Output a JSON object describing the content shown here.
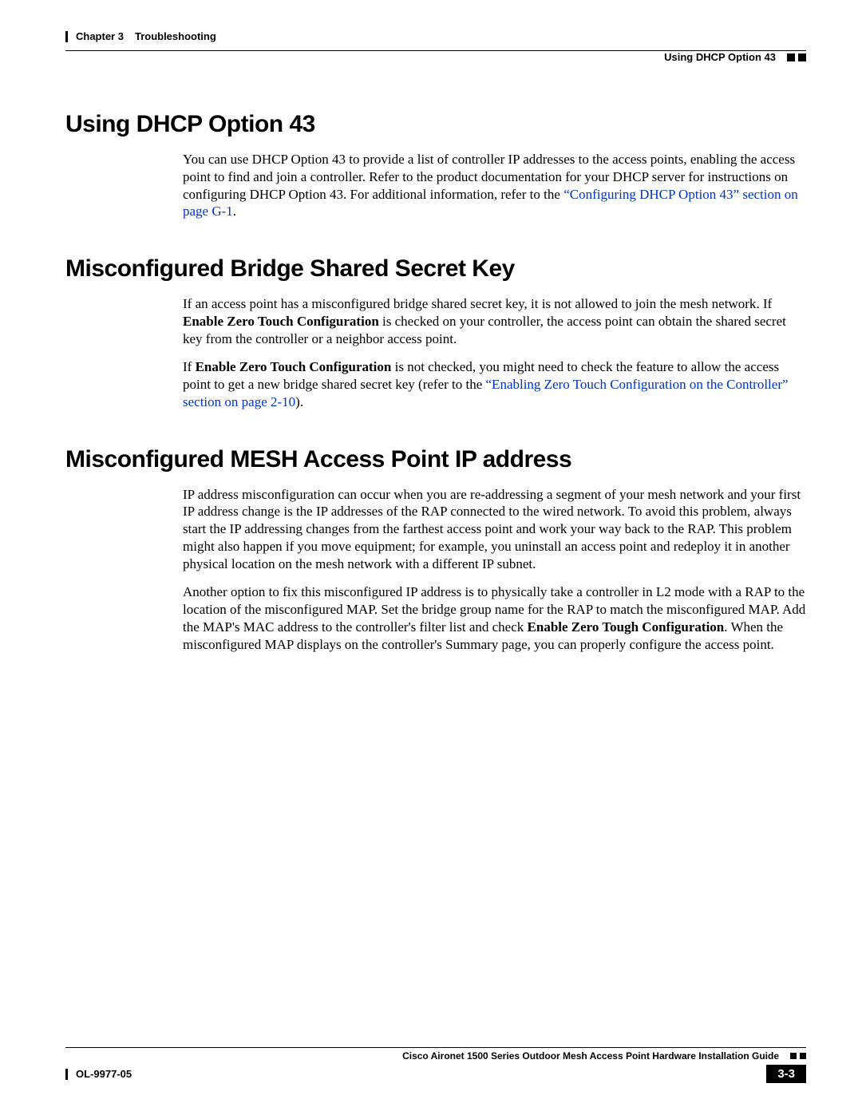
{
  "header": {
    "chapter_label": "Chapter 3",
    "chapter_title": "Troubleshooting",
    "running_head": "Using DHCP Option 43"
  },
  "sections": {
    "s1": {
      "title": "Using DHCP Option 43",
      "p1a": "You can use DHCP Option 43 to provide a list of controller IP addresses to the access points, enabling the access point to find and join a controller. Refer to the product documentation for your DHCP server for instructions on configuring DHCP Option 43. For additional information, refer to the ",
      "p1link": "“Configuring DHCP Option 43” section on page G-1",
      "p1b": "."
    },
    "s2": {
      "title": "Misconfigured Bridge Shared Secret Key",
      "p1a": "If an access point has a misconfigured bridge shared secret key, it is not allowed to join the mesh network. If ",
      "p1bold": "Enable Zero Touch Configuration",
      "p1b": " is checked on your controller, the access point can obtain the shared secret key from the controller or a neighbor access point.",
      "p2a": "If ",
      "p2bold": "Enable Zero Touch Configuration",
      "p2b": " is not checked, you might need to check the feature to allow the access point to get a new bridge shared secret key (refer to the ",
      "p2link": "“Enabling Zero Touch Configuration on the Controller” section on page 2-10",
      "p2c": ")."
    },
    "s3": {
      "title": "Misconfigured MESH Access Point IP address",
      "p1": "IP address misconfiguration can occur when you are re-addressing a segment of your mesh network and your first IP address change is the IP addresses of the RAP connected to the wired network. To avoid this problem, always start the IP addressing changes from the farthest access point and work your way back to the RAP. This problem might also happen if you move equipment; for example, you uninstall an access point and redeploy it in another physical location on the mesh network with a different IP subnet.",
      "p2a": "Another option to fix this misconfigured IP address is to physically take a controller in L2 mode with a RAP to the location of the misconfigured MAP. Set the bridge group name for the RAP to match the misconfigured MAP. Add the MAP's MAC address to the controller's filter list and check ",
      "p2bold": "Enable Zero Tough Configuration",
      "p2b": ". When the misconfigured MAP displays on the controller's Summary page, you can properly configure the access point."
    }
  },
  "footer": {
    "guide": "Cisco Aironet 1500 Series Outdoor Mesh Access Point Hardware Installation Guide",
    "doc_id": "OL-9977-05",
    "page": "3-3"
  }
}
